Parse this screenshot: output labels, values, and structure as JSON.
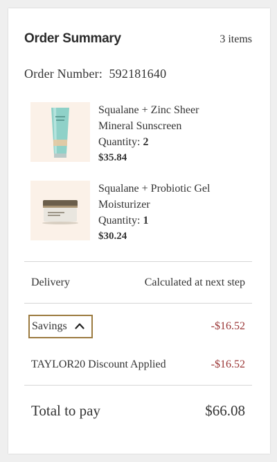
{
  "summary": {
    "title": "Order Summary",
    "item_count": "3 items",
    "order_number_label": "Order Number:",
    "order_number": "592181640"
  },
  "items": [
    {
      "name_line1": "Squalane + Zinc Sheer",
      "name_line2": "Mineral Sunscreen",
      "quantity_label": "Quantity:",
      "quantity": "2",
      "price": "$35.84",
      "image_icon": "sunscreen-tube-icon"
    },
    {
      "name_line1": "Squalane + Probiotic Gel",
      "name_line2": "Moisturizer",
      "quantity_label": "Quantity:",
      "quantity": "1",
      "price": "$30.24",
      "image_icon": "moisturizer-jar-icon"
    }
  ],
  "delivery": {
    "label": "Delivery",
    "value": "Calculated at next step"
  },
  "savings": {
    "label": "Savings",
    "value": "-$16.52"
  },
  "discount": {
    "label": "TAYLOR20 Discount Applied",
    "value": "-$16.52"
  },
  "total": {
    "label": "Total to pay",
    "value": "$66.08"
  },
  "colors": {
    "accent_border": "#9b7a3f",
    "negative": "#9a3535",
    "thumb_bg": "#fbf1e8"
  }
}
